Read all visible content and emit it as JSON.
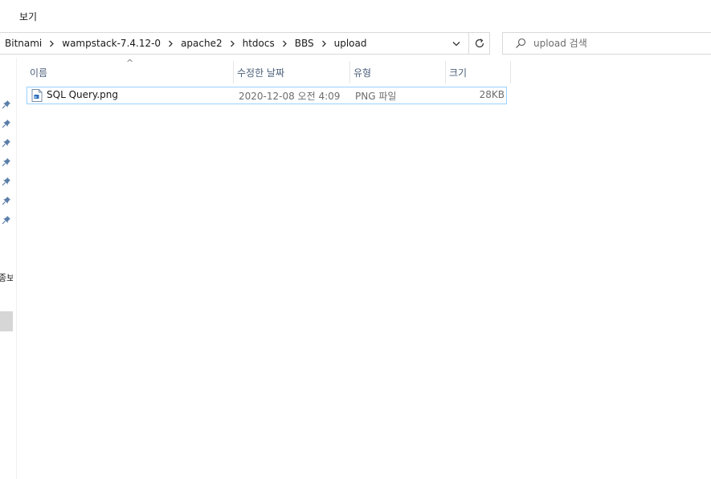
{
  "ribbon": {
    "view_tab": "보기"
  },
  "address": {
    "crumbs": [
      "Bitnami",
      "wampstack-7.4.12-0",
      "apache2",
      "htdocs",
      "BBS",
      "upload"
    ]
  },
  "search": {
    "placeholder": "upload 검색"
  },
  "nav": {
    "cut_text": "종보"
  },
  "columns": {
    "name": "이름",
    "modified": "수정한 날짜",
    "type": "유형",
    "size": "크기"
  },
  "files": [
    {
      "name": "SQL Query.png",
      "modified": "2020-12-08 오전 4:09",
      "type": "PNG 파일",
      "size": "28KB"
    }
  ],
  "colors": {
    "header_text": "#4c607a",
    "selection_border": "#99d1ff",
    "pin": "#5a7ea8"
  }
}
